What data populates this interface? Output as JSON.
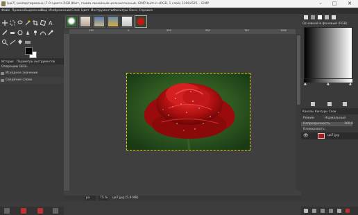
{
  "window": {
    "title": "[цв7] (импортировано)-7.0 (цвета RGB 8бит, гамма-линейный целочисленный, GIMP built-in sRGB, 1 слой) 1300x525 – GIMP",
    "minimize_symbol": "–",
    "maximize_symbol": "□",
    "close_symbol": "✕"
  },
  "menu": [
    "Файл",
    "Правка",
    "Выделение",
    "Вид",
    "Изображение",
    "Слой",
    "Цвет",
    "Инструменты",
    "Фильтры",
    "Окна",
    "Справка"
  ],
  "toolbox": {
    "dock_tabs": [
      "История",
      "Параметры инструментов"
    ],
    "panel_title": "Операции GEGL",
    "history": [
      "Исходное значение",
      "Сведение слоев"
    ],
    "tool_icons": [
      "move-icon",
      "rect-select-icon",
      "lasso-icon",
      "fuzzy-select-icon",
      "crop-icon",
      "transform-icon",
      "text-icon",
      "paint-icon",
      "eraser-icon",
      "clone-icon",
      "smudge-icon",
      "dodge-icon",
      "path-icon",
      "color-picker-icon",
      "zoom-icon",
      "measure-icon",
      "bucket-icon",
      "gradient-icon"
    ]
  },
  "image_tabs": {
    "count": 6,
    "selected_index": 5
  },
  "canvas": {
    "ruler_ticks": [
      "150",
      "0",
      "250",
      "500",
      "750",
      "1000"
    ]
  },
  "statusbar": {
    "unit": "px",
    "zoom": "75 %",
    "file": "цв7.jpg (5,9 MB)"
  },
  "right_dock": {
    "gradient_title": "Основной в фоновый (RGB)",
    "layer_tabs": [
      "Каналы",
      "Контуры",
      "Слои"
    ],
    "mode_label": "Режим",
    "mode_value": "Нормальный",
    "opacity_label": "Непрозрачность",
    "opacity_value": "100,0",
    "lock_label": "Блокировать:",
    "layer_name": "цв7.jpg",
    "eye_symbol": "👁"
  },
  "colors": {
    "fg": "#000000",
    "bg": "#ffffff",
    "accent_red": "#c01818",
    "selection": "#d8d800"
  }
}
